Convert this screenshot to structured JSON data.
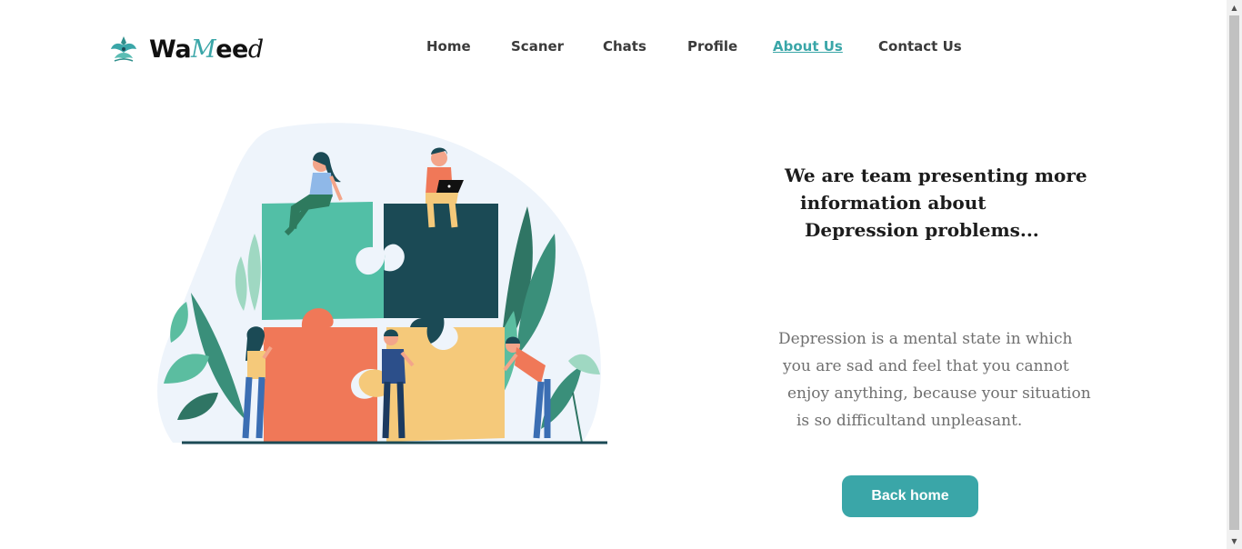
{
  "header": {
    "logo": {
      "part1": "Wa",
      "part2": "M",
      "part3": "ee",
      "part4": "d",
      "icon": "lotus-logo-icon"
    },
    "nav": [
      {
        "label": "Home",
        "active": false
      },
      {
        "label": "Scaner",
        "active": false
      },
      {
        "label": "Chats",
        "active": false
      },
      {
        "label": "Profile",
        "active": false
      },
      {
        "label": "About Us",
        "active": true
      },
      {
        "label": "Contact Us",
        "active": false
      }
    ]
  },
  "main": {
    "headline": [
      "We are team presenting more",
      "information about",
      "Depression problems..."
    ],
    "paragraph": [
      "Depression is a mental state in which",
      "you are sad and feel that you cannot",
      "enjoy anything, because your situation",
      "is so difficultand unpleasant."
    ],
    "button_label": "Back home",
    "illustration": "team-puzzle-illustration"
  },
  "colors": {
    "accent": "#3aa6a8",
    "puzzle_green": "#52bfa6",
    "puzzle_dark": "#1b4a55",
    "puzzle_orange": "#f07858",
    "puzzle_yellow": "#f5c97a"
  }
}
